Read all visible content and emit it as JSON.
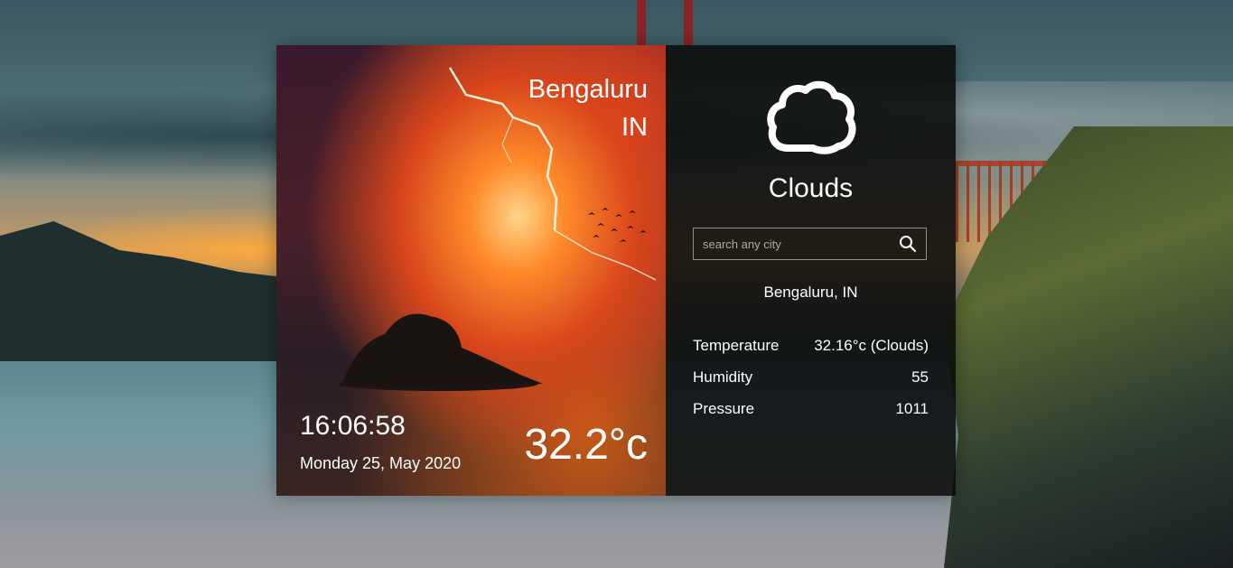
{
  "city": {
    "name": "Bengaluru",
    "country": "IN"
  },
  "clock": {
    "time": "16:06:58",
    "date": "Monday 25, May 2020"
  },
  "current": {
    "temperature_display": "32.2°c",
    "condition": "Clouds",
    "icon": "cloud-icon"
  },
  "search": {
    "placeholder": "search any city",
    "value": ""
  },
  "result": {
    "location": "Bengaluru, IN",
    "rows": [
      {
        "label": "Temperature",
        "value": "32.16°c (Clouds)"
      },
      {
        "label": "Humidity",
        "value": "55"
      },
      {
        "label": "Pressure",
        "value": "1011"
      }
    ]
  }
}
